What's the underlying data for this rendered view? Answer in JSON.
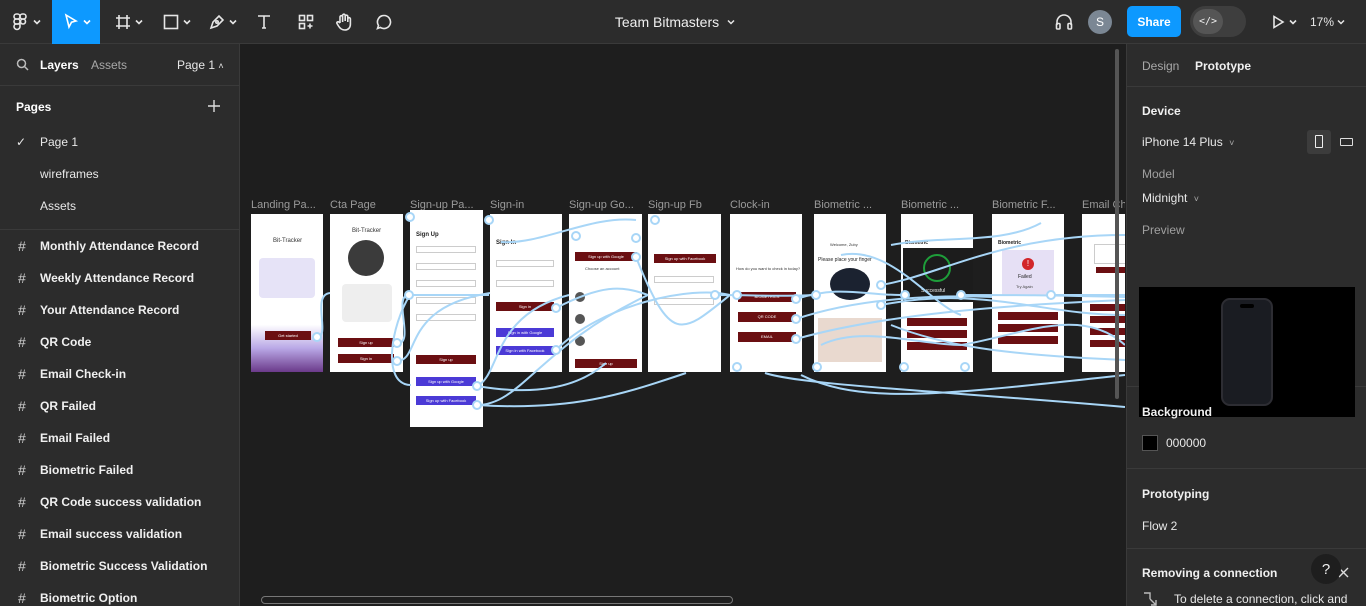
{
  "toolbar": {
    "file_title": "Team Bitmasters",
    "avatar_initial": "S",
    "share_label": "Share",
    "dev_mode_glyph": "</>",
    "zoom_label": "17%",
    "icons": [
      "figma-menu-icon",
      "move-tool-icon",
      "frame-tool-icon",
      "shape-tool-icon",
      "pen-tool-icon",
      "text-tool-icon",
      "components-icon",
      "hand-tool-icon",
      "comment-icon",
      "headphones-icon",
      "play-icon"
    ]
  },
  "left_panel": {
    "tab_layers": "Layers",
    "tab_assets": "Assets",
    "page_selector": "Page 1",
    "pages_heading": "Pages",
    "pages": [
      {
        "label": "Page 1",
        "selected": true
      },
      {
        "label": "wireframes",
        "selected": false
      },
      {
        "label": "Assets",
        "selected": false
      }
    ],
    "layers": [
      "Monthly Attendance Record",
      "Weekly Attendance Record",
      "Your Attendance Record",
      "QR Code",
      "Email Check-in",
      "QR Failed",
      "Email Failed",
      "Biometric Failed",
      "QR Code success validation",
      "Email success validation",
      "Biometric Success Validation",
      "Biometric Option"
    ]
  },
  "canvas": {
    "background": "#1e1e1e",
    "frame_labels": [
      "Landing Pa...",
      "Cta Page",
      "Sign-up Pa...",
      "Sign-in",
      "Sign-up Go...",
      "Sign-up Fb",
      "Clock-in",
      "Biometric ...",
      "Biometric ...",
      "Biometric F...",
      "Email Ch..."
    ],
    "frames": [
      {
        "title": "Bit-Tracker",
        "button": "Get started"
      },
      {
        "title": "Bit-Tracker",
        "buttons": [
          "Sign up",
          "Sign in"
        ]
      },
      {
        "title": "Sign Up",
        "fields": [
          "Full Name",
          "Email",
          "",
          "Password",
          "Confirm Password"
        ],
        "buttons": [
          "Sign up",
          "Sign up with Google",
          "Sign up with Facebook"
        ]
      },
      {
        "title": "Sign In",
        "fields": [
          "Email",
          "Password"
        ],
        "buttons": [
          "Sign in",
          "Sign in with Google",
          "Sign in with Facebook"
        ]
      },
      {
        "buttons": [
          "Sign up with Google",
          "Sign up"
        ],
        "text": "Choose an account"
      },
      {
        "buttons": [
          "Sign up with Facebook"
        ]
      },
      {
        "text": "How do you want to check in today?",
        "buttons": [
          "BIOMETRICS",
          "QR CODE",
          "EMAIL"
        ]
      },
      {
        "text": "Please place your finger",
        "name": "Welcome, Zuby"
      },
      {
        "title": "Biometric",
        "text": "Successful"
      },
      {
        "title": "Biometric",
        "text": "Failed",
        "button": "Try Again"
      },
      {}
    ],
    "colors": {
      "accent": "#0d99ff",
      "wire": "#a8d6f7",
      "button_dark": "#6b0f12",
      "purple": "#4b3ad6"
    }
  },
  "right_panel": {
    "tab_design": "Design",
    "tab_prototype": "Prototype",
    "device_heading": "Device",
    "device_value": "iPhone 14 Plus",
    "model_label": "Model",
    "model_value": "Midnight",
    "preview_label": "Preview",
    "background_heading": "Background",
    "background_hex": "000000",
    "background_color": "#000000",
    "prototyping_heading": "Prototyping",
    "flow_label": "Flow 2",
    "removing_heading": "Removing a connection",
    "removing_text": "To delete a connection, click and",
    "help_label": "?"
  }
}
